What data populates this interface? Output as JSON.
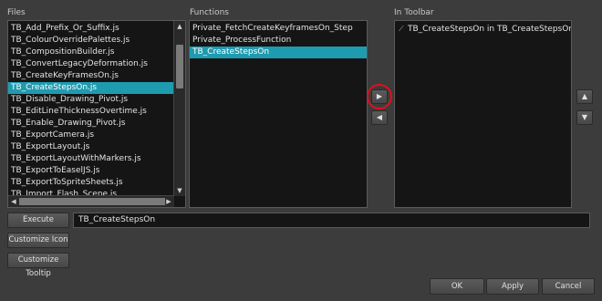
{
  "files": {
    "label": "Files",
    "items": [
      "TB_Add_Prefix_Or_Suffix.js",
      "TB_ColourOverridePalettes.js",
      "TB_CompositionBuilder.js",
      "TB_ConvertLegacyDeformation.js",
      "TB_CreateKeyFramesOn.js",
      "TB_CreateStepsOn.js",
      "TB_Disable_Drawing_Pivot.js",
      "TB_EditLineThicknessOvertime.js",
      "TB_Enable_Drawing_Pivot.js",
      "TB_ExportCamera.js",
      "TB_ExportLayout.js",
      "TB_ExportLayoutWithMarkers.js",
      "TB_ExportToEaselJS.js",
      "TB_ExportToSpriteSheets.js",
      "TB_Import_Flash_Scene.js"
    ],
    "selected_index": 5
  },
  "functions": {
    "label": "Functions",
    "items": [
      "Private_FetchCreateKeyframesOn_Step",
      "Private_ProcessFunction",
      "TB_CreateStepsOn"
    ],
    "selected_index": 2
  },
  "toolbar": {
    "label": "In Toolbar",
    "items": [
      "TB_CreateStepsOn in TB_CreateStepsOn.js"
    ]
  },
  "arrows": {
    "add": "▶",
    "remove": "◀",
    "up": "▲",
    "down": "▼",
    "scroll_up": "▲",
    "scroll_down": "▼",
    "scroll_left": "◀",
    "scroll_right": "▶"
  },
  "execute": {
    "button_label": "Execute",
    "field_value": "TB_CreateStepsOn"
  },
  "customize_icon_label": "Customize Icon",
  "customize_tooltip_label": "Customize Tooltip",
  "footer": {
    "ok": "OK",
    "apply": "Apply",
    "cancel": "Cancel"
  },
  "colors": {
    "selection": "#1f9bb0",
    "highlight_circle": "#e0101a"
  }
}
